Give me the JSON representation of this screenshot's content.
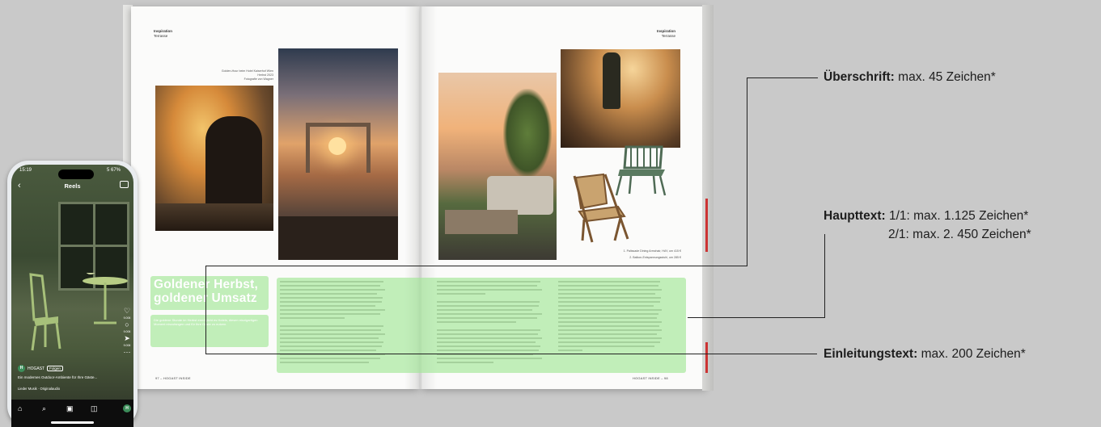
{
  "magazine": {
    "left_page": {
      "section_label": "Inspiration",
      "section_sub": "Terrasse",
      "photo_caption": [
        "Golden-Hour beim Hotel Kaiserhof Wien",
        "Herbst 2023",
        "Fotografie von Wagner"
      ],
      "headline_line1": "Goldener Herbst,",
      "headline_line2": "goldener Umsatz",
      "intro": "Die goldene Stunde im Herbst ermöglicht es Hotels, diesen einzigartigen Moment einzufangen und für Ihre Gäste zu nutzen.",
      "footer": "97 – HOGAST INSIDE"
    },
    "right_page": {
      "section_label": "Inspiration",
      "section_sub": "Terrasse",
      "product_caption_1": "1. Palissade Dining Armchair, HAY, um 415 €",
      "product_caption_2": "2. Balkon-Entspannungsstuhl, um 285 €",
      "footer": "HOGAST INSIDE – 98"
    }
  },
  "annotations": {
    "headline": {
      "label": "Überschrift:",
      "value": "max. 45 Zeichen*"
    },
    "body": {
      "label": "Haupttext:",
      "line1": "1/1:  max. 1.125 Zeichen*",
      "line2": "2/1: max. 2. 450 Zeichen*"
    },
    "intro": {
      "label": "Einleitungstext:",
      "value": "max. 200 Zeichen*"
    }
  },
  "phone": {
    "time": "15:19",
    "battery": "5 67%",
    "title": "Reels",
    "account": "HOGAST",
    "follow": "Folgen",
    "caption": "Ein modernes Outdoor-Ambiente für Ihre Gäste...",
    "audio": "Lieder Musik · Originalaudio",
    "counts": [
      "9.006",
      "9.006",
      "9.006"
    ],
    "avatar_letter": "H"
  },
  "colors": {
    "highlight": "#a2e696",
    "background": "#c9c9c9",
    "brand_green": "#3c8d5a"
  }
}
